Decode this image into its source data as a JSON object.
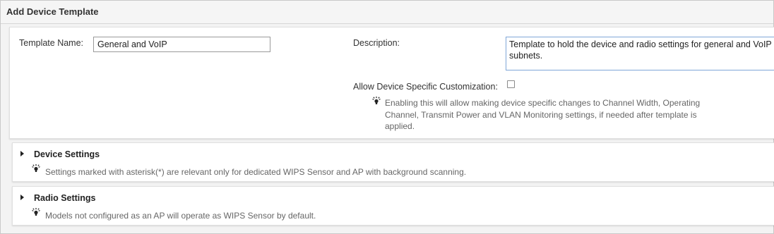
{
  "window": {
    "title": "Add Device Template"
  },
  "form": {
    "template_name_label": "Template Name:",
    "template_name_value": "General and VoIP",
    "description_label": "Description:",
    "description_value": "Template to hold the device and radio settings for general and VoIP subnets.",
    "allow_custom_label": "Allow Device Specific Customization:",
    "allow_custom_checked": false,
    "allow_custom_hint": "Enabling this will allow making device specific changes to Channel Width, Operating Channel, Transmit Power and VLAN Monitoring settings, if needed after template is applied."
  },
  "sections": {
    "device": {
      "title": "Device Settings",
      "hint": "Settings marked with asterisk(*) are relevant only for dedicated WIPS Sensor and AP with background scanning."
    },
    "radio": {
      "title": "Radio Settings",
      "hint": "Models not configured as an AP will operate as WIPS Sensor by default."
    }
  },
  "icons": {
    "hint": "lightbulb-icon",
    "expand": "caret-right-icon"
  },
  "colors": {
    "textarea_focus_border": "#7fa7d8",
    "panel_bg": "#ffffff",
    "page_bg": "#f3f3f3"
  }
}
